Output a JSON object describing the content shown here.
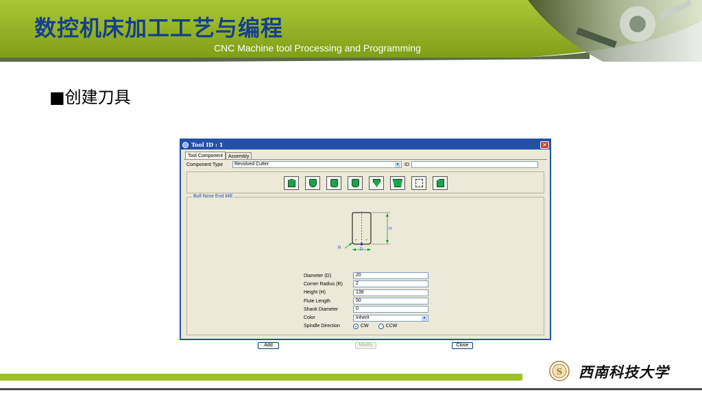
{
  "slide": {
    "title_cn": "数控机床加工工艺与编程",
    "title_en": "CNC Machine tool Processing and Programming",
    "subtitle": "■创建刀具",
    "footer_university": "西南科技大学"
  },
  "dialog": {
    "title": "Tool  ID  :  1",
    "tabs": [
      {
        "label": "Tool Component",
        "active": true
      },
      {
        "label": "Assembly",
        "active": false
      }
    ],
    "component_type_label": "Component Type",
    "component_type_value": "Revolved Cutter",
    "id_label": "ID",
    "id_value": "",
    "tool_icons": [
      "flat-end-mill-icon",
      "ball-end-mill-icon",
      "bull-nose-end-mill-icon",
      "taper-end-mill-icon",
      "chamfer-mill-icon",
      "dovetail-mill-icon",
      "drill-icon",
      "tap-icon"
    ],
    "group_title": "Bull Nose End Mill",
    "diagram_labels": {
      "h": "H",
      "r": "R",
      "d": "D"
    },
    "fields": [
      {
        "label": "Diameter (D)",
        "value": "20"
      },
      {
        "label": "Corner Radius (R)",
        "value": "2"
      },
      {
        "label": "Height (H)",
        "value": "138"
      },
      {
        "label": "Flute Length",
        "value": "50"
      },
      {
        "label": "Shank Diameter",
        "value": "0"
      }
    ],
    "color_label": "Color",
    "color_value": "Inherit",
    "spindle_label": "Spindle Direction",
    "spindle_options": [
      {
        "label": "CW",
        "selected": true
      },
      {
        "label": "CCW",
        "selected": false
      }
    ],
    "buttons": {
      "add": "Add",
      "modify": "Modify",
      "close": "Close"
    }
  },
  "colors": {
    "banner_green": "#8fb221",
    "title_blue": "#15408a",
    "window_blue": "#2450a8",
    "icon_green": "#18a64a",
    "footer_green": "#9ec126"
  }
}
